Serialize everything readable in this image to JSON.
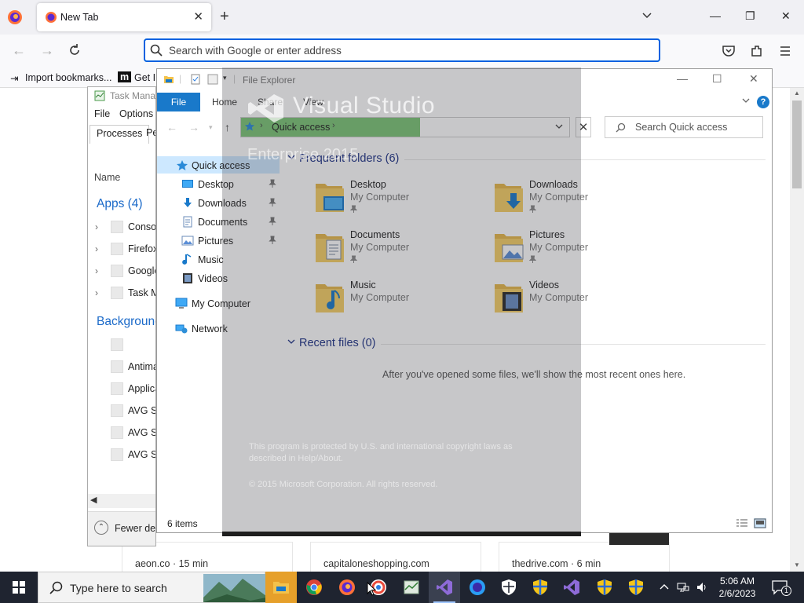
{
  "browser": {
    "tab_title": "New Tab",
    "url_placeholder": "Search with Google or enter address",
    "bookmarks": [
      "Import bookmarks...",
      "Get In"
    ],
    "stories": [
      {
        "label": "aeon.co · 15 min"
      },
      {
        "label": "capitaloneshopping.com"
      },
      {
        "label": "thedrive.com · 6 min"
      }
    ]
  },
  "task_manager": {
    "title": "Task Manager",
    "menu": [
      "File",
      "Options"
    ],
    "tabs": [
      "Processes",
      "Performance"
    ],
    "column_header": "Name",
    "apps_group": "Apps (4)",
    "apps": [
      "Console Window Host",
      "Firefox",
      "Google Chrome",
      "Task Manager"
    ],
    "background_group": "Background processes",
    "background": [
      "",
      "Antimalware Service Executable",
      "Application Frame Host",
      "AVG Secure Browser",
      "AVG Secure Browser",
      "AVG Secure Browser"
    ],
    "footer": "Fewer details"
  },
  "explorer": {
    "title": "File Explorer",
    "ribbon_tabs": [
      "File",
      "Home",
      "Share",
      "View"
    ],
    "address": "Quick access",
    "search_placeholder": "Search Quick access",
    "nav": {
      "quick_access": "Quick access",
      "pinned": [
        "Desktop",
        "Downloads",
        "Documents",
        "Pictures"
      ],
      "unpinned": [
        "Music",
        "Videos"
      ],
      "my_computer": "My Computer",
      "network": "Network"
    },
    "frequent_header": "Frequent folders (6)",
    "folders": [
      {
        "name": "Desktop",
        "location": "My Computer"
      },
      {
        "name": "Downloads",
        "location": "My Computer"
      },
      {
        "name": "Documents",
        "location": "My Computer"
      },
      {
        "name": "Pictures",
        "location": "My Computer"
      },
      {
        "name": "Music",
        "location": "My Computer"
      },
      {
        "name": "Videos",
        "location": "My Computer"
      }
    ],
    "recent_header": "Recent files (0)",
    "recent_empty": "After you've opened some files, we'll show the most recent ones here.",
    "status": "6 items"
  },
  "splash": {
    "brand": "Visual Studio",
    "edition": "Enterprise 2015",
    "legal": "This program is protected by U.S. and international copyright laws as described in Help/About.",
    "copyright": "© 2015 Microsoft Corporation. All rights reserved."
  },
  "taskbar": {
    "search_text": "Type here to search",
    "time": "5:06 AM",
    "date": "2/6/2023",
    "notifications": "1"
  },
  "colors": {
    "accent": "#0061e0",
    "explorer_blue": "#1979ca",
    "address_highlight": "#7cc576",
    "taskbar": "#1f2430"
  }
}
